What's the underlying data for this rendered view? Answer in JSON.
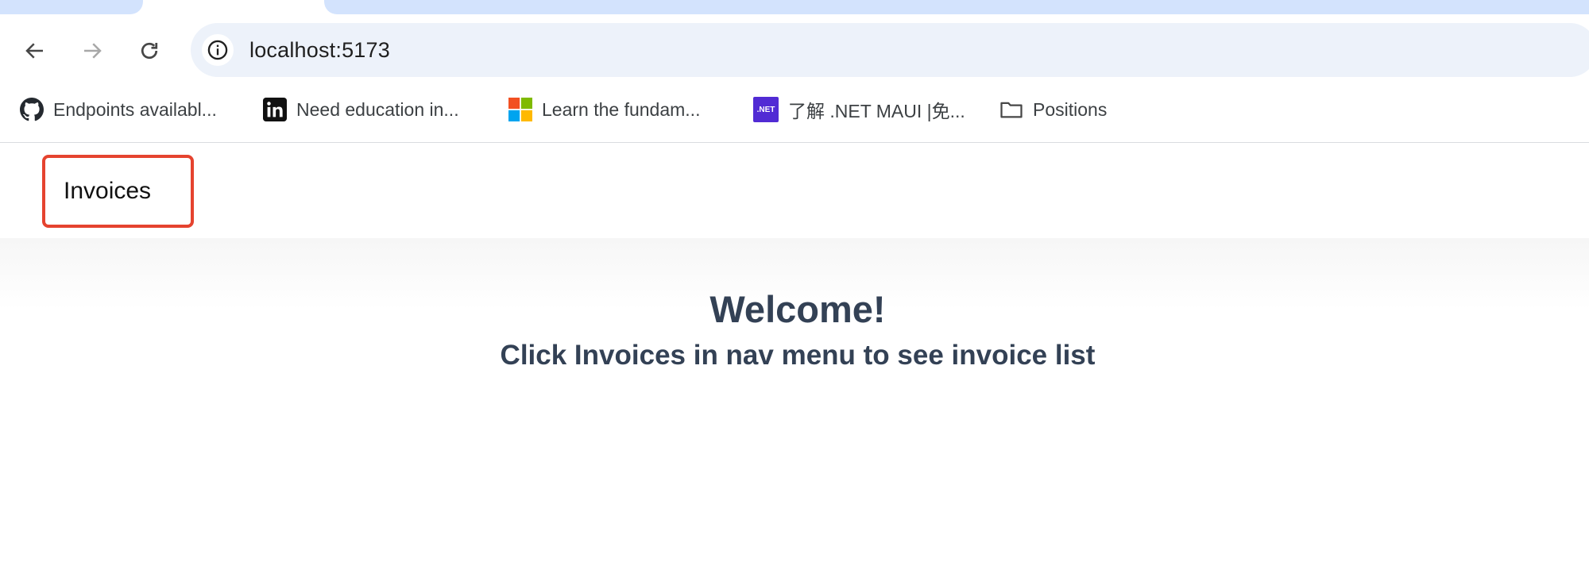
{
  "browser": {
    "url": "localhost:5173",
    "bookmarks": [
      {
        "icon": "github-icon",
        "label": "Endpoints availabl..."
      },
      {
        "icon": "linkedin-icon",
        "label": "Need education in..."
      },
      {
        "icon": "microsoft-icon",
        "label": "Learn the fundam..."
      },
      {
        "icon": "dotnet-icon",
        "label": "了解 .NET MAUI |免..."
      },
      {
        "icon": "folder-icon",
        "label": "Positions"
      }
    ],
    "dotnet_badge": ".NET"
  },
  "app": {
    "nav": {
      "invoices_label": "Invoices"
    },
    "main": {
      "title": "Welcome!",
      "subtitle": "Click Invoices in nav menu to see invoice list"
    }
  },
  "colors": {
    "highlight_border": "#e5432f",
    "heading": "#334155",
    "omnibox_bg": "#edf2fa",
    "tab_bg": "#d3e3fd"
  }
}
